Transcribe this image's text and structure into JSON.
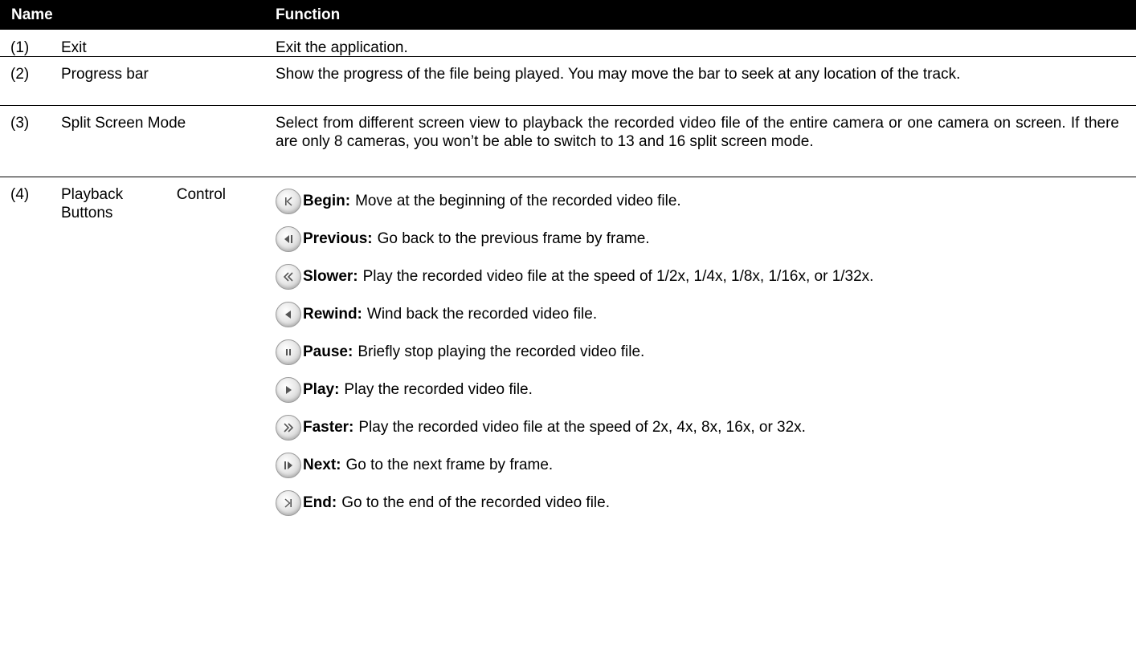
{
  "header": {
    "name": "Name",
    "function": "Function"
  },
  "rows": [
    {
      "num": "(1)",
      "name": "Exit",
      "function": "Exit the application."
    },
    {
      "num": "(2)",
      "name": "Progress bar",
      "function": "Show the progress of the file being played. You may move the bar to seek at any location of the track."
    },
    {
      "num": "(3)",
      "name": "Split Screen Mode",
      "function": "Select from different screen view to playback the recorded video file of the entire camera or one camera on screen. If there are only 8 cameras, you won’t be able to switch to 13 and 16 split screen mode."
    },
    {
      "num": "(4)",
      "name_line1a": "Playback",
      "name_line1b": "Control",
      "name_line2": "Buttons"
    }
  ],
  "controls": [
    {
      "icon": "begin-icon",
      "label": "Begin:",
      "desc": "Move at the beginning of the recorded video file."
    },
    {
      "icon": "previous-icon",
      "label": "Previous:",
      "desc": "Go back to the previous frame by frame."
    },
    {
      "icon": "slower-icon",
      "label": "Slower:",
      "desc": "Play the recorded video file at the speed of 1/2x, 1/4x, 1/8x, 1/16x, or 1/32x."
    },
    {
      "icon": "rewind-icon",
      "label": "Rewind:",
      "desc": "Wind back the recorded video file."
    },
    {
      "icon": "pause-icon",
      "label": "Pause:",
      "desc": "Briefly stop playing the recorded video file."
    },
    {
      "icon": "play-icon",
      "label": "Play:",
      "desc": "Play the recorded video file."
    },
    {
      "icon": "faster-icon",
      "label": "Faster:",
      "desc": "Play the recorded video file at the speed of 2x, 4x, 8x, 16x, or 32x."
    },
    {
      "icon": "next-icon",
      "label": "Next:",
      "desc": "Go to the next frame by frame."
    },
    {
      "icon": "end-icon",
      "label": "End:",
      "desc": "Go to the end of the recorded video file."
    }
  ]
}
